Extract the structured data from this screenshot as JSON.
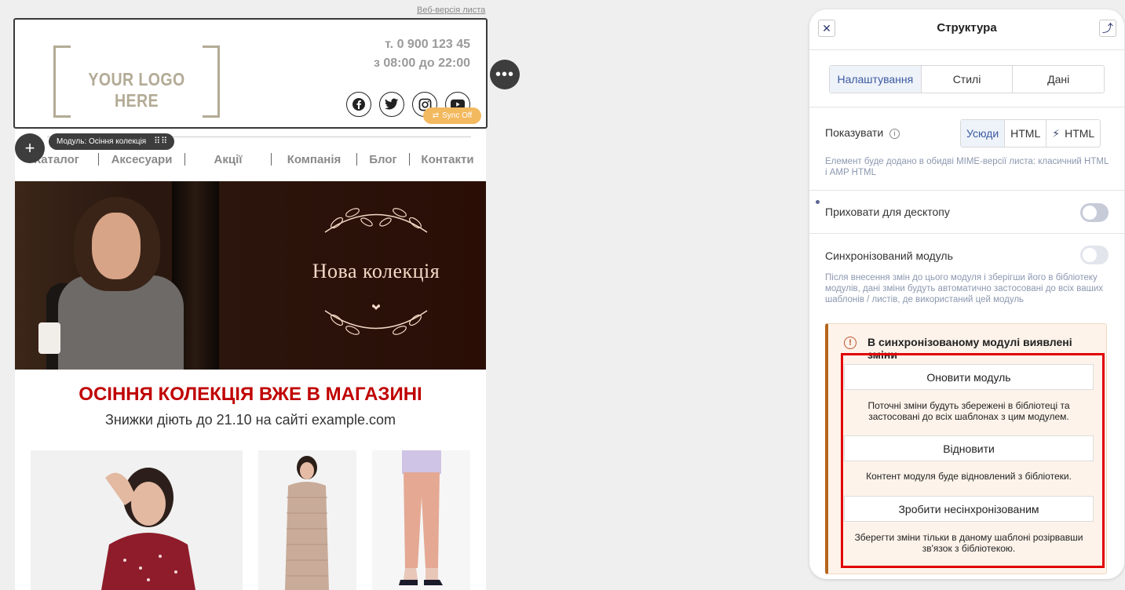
{
  "email": {
    "web_version": "Веб-версія листа",
    "logo": "YOUR LOGO HERE",
    "phone": "т. 0 900 123 45",
    "hours": "з 08:00 до 22:00",
    "sync_badge": "Sync Off",
    "module_label": "Модуль: Осіння колекція",
    "menu": [
      "Каталог",
      "Аксесуари",
      "Акції",
      "Компанія",
      "Блог",
      "Контакти"
    ],
    "hero_title": "Нова колекція",
    "promo_title": "ОСІННЯ КОЛЕКЦІЯ ВЖЕ В МАГАЗИНІ",
    "promo_sub": "Знижки діють до 21.10 на сайті example.com",
    "socials": [
      "facebook-icon",
      "twitter-icon",
      "instagram-icon",
      "youtube-icon"
    ]
  },
  "panel": {
    "title": "Структура",
    "tabs": [
      "Налаштування",
      "Стилі",
      "Дані"
    ],
    "show_label": "Показувати",
    "show_options": [
      "Усюди",
      "HTML",
      "HTML"
    ],
    "show_note": "Елемент буде додано в обидві MIME-версії листа: класичний HTML і AMP HTML",
    "hide_desktop": "Приховати для десктопу",
    "synced_label": "Синхронізований модуль",
    "synced_note": "Після внесення змін до цього модуля і зберігши його в бібліотеку модулів, дані зміни будуть автоматично застосовані до всіх ваших шаблонів / листів, де використаний цей модуль",
    "warn_title": "В синхронізованому модулі виявлені зміни",
    "update_btn": "Оновити модуль",
    "update_desc": "Поточні зміни будуть збережені в бібліотеці та застосовані до всіх шаблонах з цим модулем.",
    "restore_btn": "Відновити",
    "restore_desc": "Контент модуля буде відновлений з бібліотеки.",
    "unsync_btn": "Зробити несінхронізованим",
    "unsync_desc": "Зберегти зміни тільки в даному шаблоні розірвавши зв'язок з бібліотекою."
  },
  "colors": {
    "accent": "#3a5aa0",
    "promo_red": "#c00000",
    "warn_border": "#b5651d",
    "highlight": "#e10000",
    "sync_orange": "#f3b95f"
  }
}
